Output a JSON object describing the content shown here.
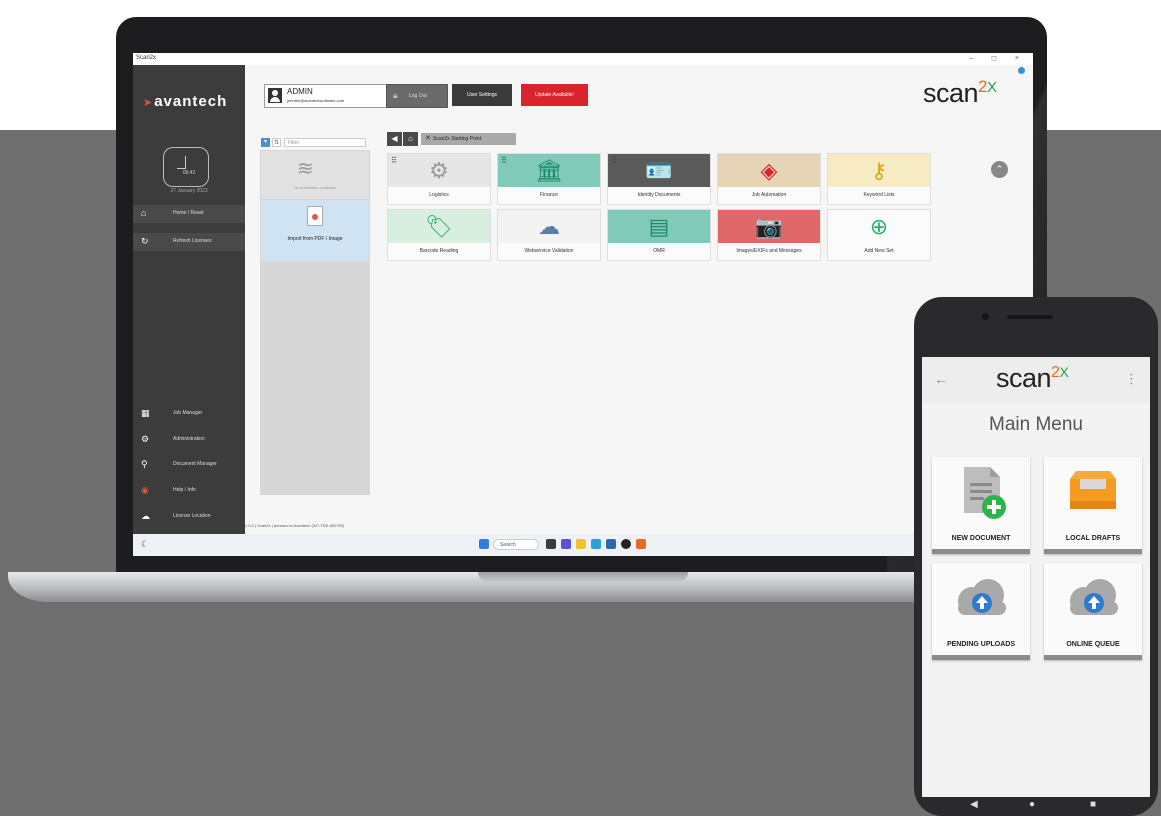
{
  "laptop": {
    "titlebar": {
      "title": "Scan2x",
      "controls": "– ◻ ×"
    },
    "sidebar": {
      "logo": "avantech",
      "clock_time": "09:42",
      "clock_date": "27 January 2023",
      "items_top": [
        {
          "label": "Home / Reset",
          "icon": "home-icon"
        },
        {
          "label": "Refresh Licenses",
          "icon": "refresh-icon"
        }
      ],
      "items_bottom": [
        {
          "label": "Job Manager",
          "icon": "grid-icon"
        },
        {
          "label": "Administration",
          "icon": "gear-icon"
        },
        {
          "label": "Document Manager",
          "icon": "search-icon"
        },
        {
          "label": "Help / Info",
          "icon": "help-icon"
        },
        {
          "label": "License Location",
          "icon": "cloud-icon"
        }
      ]
    },
    "header": {
      "user_name": "ADMIN",
      "user_email": "jennifer@avantechsoftware.com",
      "logout_label": "Log Out",
      "user_settings_label": "User Settings",
      "update_label": "Update Available!",
      "brand_main": "scan",
      "brand_two": "2",
      "brand_spark": "X"
    },
    "filter": {
      "placeholder": "Filter",
      "empty_label": "No subfolders available",
      "import_label": "Import from PDF / Image"
    },
    "breadcrumb": {
      "label": "Scan2x Starting Point"
    },
    "tiles": [
      {
        "label": "Logistics",
        "icon": "gears-icon",
        "bg": "#e6e6e6",
        "fg": "#9a9a9a",
        "glyph": "⚙"
      },
      {
        "label": "Finance",
        "icon": "bank-icon",
        "bg": "#7fcab9",
        "fg": "#1f8a6a",
        "glyph": "🏛"
      },
      {
        "label": "Identity Documents",
        "icon": "id-card-icon",
        "bg": "#5a5a5a",
        "fg": "#ffffff",
        "glyph": "🪪"
      },
      {
        "label": "Job Automation",
        "icon": "layers-icon",
        "bg": "#e6d4b6",
        "fg": "#d9232d",
        "glyph": "◈"
      },
      {
        "label": "Keyword Lists",
        "icon": "key-icon",
        "bg": "#f6ebc3",
        "fg": "#d9a814",
        "glyph": "⚷"
      },
      {
        "label": "Barcode Reading",
        "icon": "tag-icon",
        "bg": "#d8eedf",
        "fg": "#2fae72",
        "glyph": "🏷"
      },
      {
        "label": "Webservice Validation",
        "icon": "cloud-sync-icon",
        "bg": "#f3f3f3",
        "fg": "#5a7fa6",
        "glyph": "☁"
      },
      {
        "label": "OMR",
        "icon": "form-icon",
        "bg": "#7fcab9",
        "fg": "#1f8a6a",
        "glyph": "▤"
      },
      {
        "label": "Images/EXIFs and Messages",
        "icon": "camera-icon",
        "bg": "#e06868",
        "fg": "#ffffff",
        "glyph": "📷"
      },
      {
        "label": "Add New Set",
        "icon": "plus-circle-icon",
        "bg": "#fbfbfb",
        "fg": "#2fae72",
        "glyph": "⊕"
      }
    ],
    "status": "2.0.0 | Scan2x | licensed to Avantech (INT-TEN-800752)",
    "taskbar": {
      "search_label": "Search"
    }
  },
  "phone": {
    "app_bar": {
      "back": "←",
      "menu": "⋮",
      "brand_main": "scan",
      "brand_two": "2",
      "brand_spark": "X"
    },
    "title": "Main Menu",
    "cards": [
      {
        "label": "NEW DOCUMENT",
        "icon": "new-document-icon"
      },
      {
        "label": "LOCAL DRAFTS",
        "icon": "drafts-tray-icon"
      },
      {
        "label": "PENDING UPLOADS",
        "icon": "cloud-upload-icon"
      },
      {
        "label": "ONLINE QUEUE",
        "icon": "cloud-upload-icon"
      }
    ],
    "nav": {
      "back": "◀",
      "home": "●",
      "recent": "■"
    }
  }
}
